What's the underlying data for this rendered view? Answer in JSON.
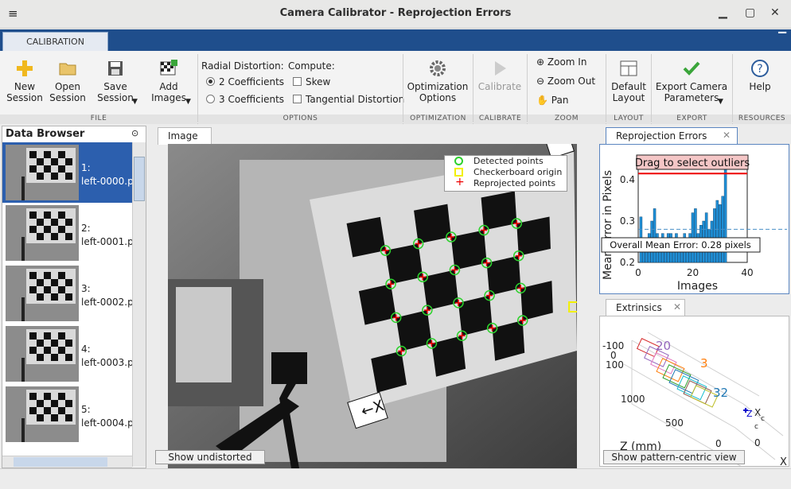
{
  "window": {
    "title": "Camera Calibrator - Reprojection Errors"
  },
  "ribbon_tab": "CALIBRATION",
  "ribbon": {
    "new_session": "New\nSession",
    "open_session": "Open\nSession",
    "save_session": "Save\nSession",
    "add_images": "Add\nImages",
    "radial_label": "Radial Distortion:",
    "coef2": "2 Coefficients",
    "coef3": "3 Coefficients",
    "compute_label": "Compute:",
    "skew": "Skew",
    "tangential": "Tangential Distortion",
    "optimization": "Optimization\nOptions",
    "calibrate": "Calibrate",
    "zoom_in": "Zoom In",
    "zoom_out": "Zoom Out",
    "pan": "Pan",
    "default_layout": "Default\nLayout",
    "export_params": "Export Camera\nParameters",
    "help": "Help",
    "groups": {
      "file": "FILE",
      "options": "OPTIONS",
      "optimization": "OPTIMIZATION",
      "calibrate": "CALIBRATE",
      "zoom": "ZOOM",
      "layout": "LAYOUT",
      "export": "EXPORT",
      "resources": "RESOURCES"
    }
  },
  "data_browser": {
    "title": "Data Browser",
    "items": [
      {
        "label": "1:\nleft-0000.png"
      },
      {
        "label": "2:\nleft-0001.p"
      },
      {
        "label": "3:\nleft-0002.p"
      },
      {
        "label": "4:\nleft-0003.p"
      },
      {
        "label": "5:\nleft-0004.p"
      }
    ]
  },
  "image_panel": {
    "tab": "Image",
    "legend": {
      "detected": "Detected points",
      "origin": "Checkerboard origin",
      "reprojected": "Reprojected points"
    },
    "axis_x_label": "X",
    "axis_y_label": "Y",
    "button": "Show undistorted"
  },
  "reprojection_panel": {
    "tab": "Reprojection Errors",
    "overlay": "Drag to select outliers",
    "mean_label": "Overall Mean Error: 0.28 pixels",
    "ylabel": "Mean Error in Pixels",
    "xlabel": "Images"
  },
  "extrinsics_panel": {
    "tab": "Extrinsics",
    "zlabel": "Z (mm)",
    "ticks": [
      "-100",
      "0",
      "100",
      "1000",
      "500",
      "0"
    ],
    "cam_labels": [
      "20",
      "32",
      "3"
    ],
    "axis_labels": [
      "X",
      "Z",
      "X",
      "c",
      "c"
    ],
    "button": "Show pattern-centric view"
  },
  "chart_data": {
    "type": "bar",
    "title": "",
    "ylabel": "Mean Error in Pixels",
    "xlabel": "Images",
    "xlim": [
      0,
      40
    ],
    "ylim": [
      0.2,
      0.45
    ],
    "x_ticks": [
      "0",
      "20",
      "40"
    ],
    "y_ticks": [
      "0.4",
      "0.3",
      "0.2"
    ],
    "mean": 0.28,
    "threshold": 0.415,
    "categories": [
      "1",
      "2",
      "3",
      "4",
      "5",
      "6",
      "7",
      "8",
      "9",
      "10",
      "11",
      "12",
      "13",
      "14",
      "15",
      "16",
      "17",
      "18",
      "19",
      "20",
      "21",
      "22",
      "23",
      "24",
      "25",
      "26",
      "27",
      "28",
      "29",
      "30",
      "31",
      "32"
    ],
    "values": [
      0.31,
      0.24,
      0.23,
      0.27,
      0.3,
      0.33,
      0.27,
      0.26,
      0.27,
      0.26,
      0.27,
      0.27,
      0.26,
      0.27,
      0.26,
      0.24,
      0.27,
      0.26,
      0.27,
      0.32,
      0.33,
      0.27,
      0.29,
      0.3,
      0.32,
      0.28,
      0.3,
      0.33,
      0.35,
      0.34,
      0.36,
      0.43
    ],
    "bar_color": "#1f8fd6"
  }
}
